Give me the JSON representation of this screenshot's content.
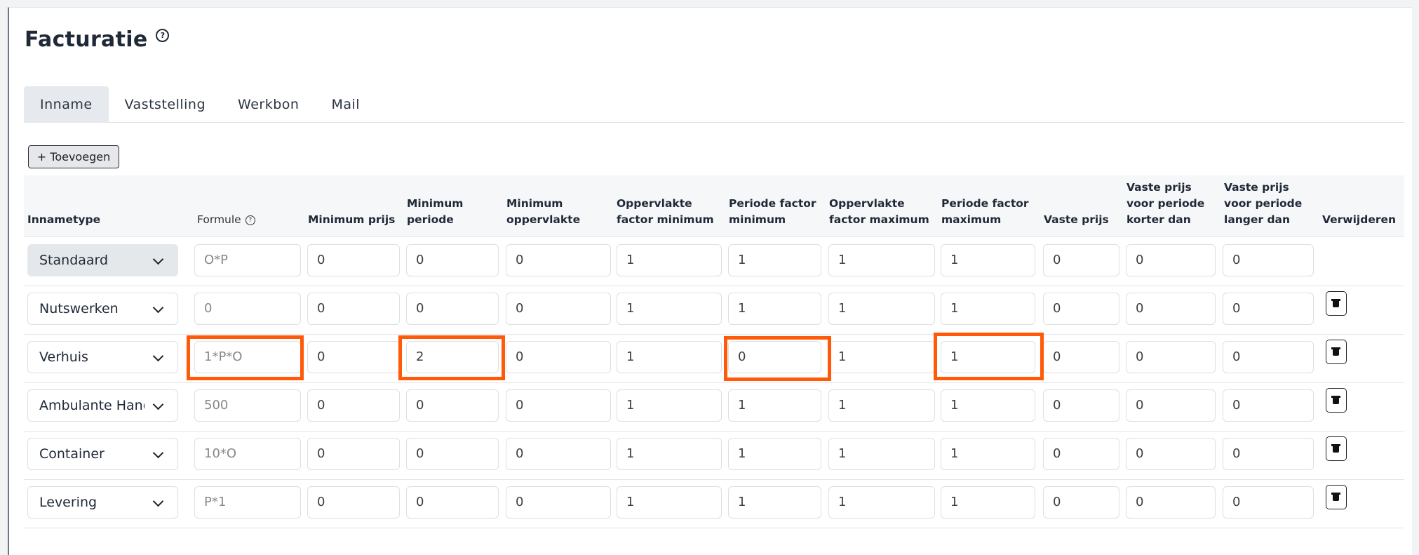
{
  "page": {
    "title": "Facturatie"
  },
  "tabs": [
    "Inname",
    "Vaststelling",
    "Werkbon",
    "Mail"
  ],
  "toolbar": {
    "add_label": "+ Toevoegen"
  },
  "table": {
    "headers": {
      "innametype": "Innametype",
      "formule": "Formule",
      "minimum_prijs": "Minimum prijs",
      "minimum_periode": [
        "Minimum",
        "periode"
      ],
      "minimum_oppervlakte": [
        "Minimum",
        "oppervlakte"
      ],
      "opp_factor_min": [
        "Oppervlakte",
        "factor minimum"
      ],
      "periode_factor_min": [
        "Periode factor",
        "minimum"
      ],
      "opp_factor_max": [
        "Oppervlakte",
        "factor maximum"
      ],
      "periode_factor_max": [
        "Periode factor",
        "maximum"
      ],
      "vaste_prijs": "Vaste prijs",
      "vaste_prijs_korter": [
        "Vaste prijs",
        "voor periode",
        "korter dan"
      ],
      "vaste_prijs_langer": [
        "Vaste prijs",
        "voor periode",
        "langer dan"
      ],
      "verwijderen": "Verwijderen"
    },
    "rows": [
      {
        "type": "Standaard",
        "formule": "O*P",
        "minimum_prijs": "0",
        "minimum_periode": "0",
        "minimum_oppervlakte": "0",
        "opp_factor_min": "1",
        "periode_factor_min": "1",
        "opp_factor_max": "1",
        "periode_factor_max": "1",
        "vaste_prijs": "0",
        "vaste_prijs_korter": "0",
        "vaste_prijs_langer": "0"
      },
      {
        "type": "Nutswerken",
        "formule": "0",
        "minimum_prijs": "0",
        "minimum_periode": "0",
        "minimum_oppervlakte": "0",
        "opp_factor_min": "1",
        "periode_factor_min": "1",
        "opp_factor_max": "1",
        "periode_factor_max": "1",
        "vaste_prijs": "0",
        "vaste_prijs_korter": "0",
        "vaste_prijs_langer": "0"
      },
      {
        "type": "Verhuis",
        "formule": "1*P*O",
        "minimum_prijs": "0",
        "minimum_periode": "2",
        "minimum_oppervlakte": "0",
        "opp_factor_min": "1",
        "periode_factor_min": "0",
        "opp_factor_max": "1",
        "periode_factor_max": "1",
        "vaste_prijs": "0",
        "vaste_prijs_korter": "0",
        "vaste_prijs_langer": "0"
      },
      {
        "type": "Ambulante Handel",
        "formule": "500",
        "minimum_prijs": "0",
        "minimum_periode": "0",
        "minimum_oppervlakte": "0",
        "opp_factor_min": "1",
        "periode_factor_min": "1",
        "opp_factor_max": "1",
        "periode_factor_max": "1",
        "vaste_prijs": "0",
        "vaste_prijs_korter": "0",
        "vaste_prijs_langer": "0"
      },
      {
        "type": "Container",
        "formule": "10*O",
        "minimum_prijs": "0",
        "minimum_periode": "0",
        "minimum_oppervlakte": "0",
        "opp_factor_min": "1",
        "periode_factor_min": "1",
        "opp_factor_max": "1",
        "periode_factor_max": "1",
        "vaste_prijs": "0",
        "vaste_prijs_korter": "0",
        "vaste_prijs_langer": "0"
      },
      {
        "type": "Levering",
        "formule": "P*1",
        "minimum_prijs": "0",
        "minimum_periode": "0",
        "minimum_oppervlakte": "0",
        "opp_factor_min": "1",
        "periode_factor_min": "1",
        "opp_factor_max": "1",
        "periode_factor_max": "1",
        "vaste_prijs": "0",
        "vaste_prijs_korter": "0",
        "vaste_prijs_langer": "0"
      }
    ]
  },
  "icons": {
    "help": "help-circle-icon",
    "chevron": "chevron-down-icon",
    "delete": "trash-icon"
  },
  "colors": {
    "highlight": "#ff5a0a",
    "active_tab": "#e6e9ed",
    "header_bg": "#f6f7f9"
  }
}
